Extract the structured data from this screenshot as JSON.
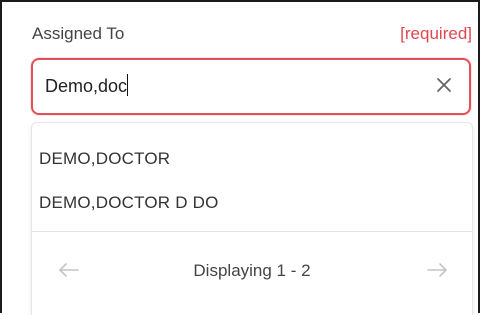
{
  "field": {
    "label": "Assigned To",
    "required_tag": "[required]",
    "value": "Demo,doc",
    "accent_color": "#e45057"
  },
  "dropdown": {
    "options": [
      {
        "label": "DEMO,DOCTOR"
      },
      {
        "label": "DEMO,DOCTOR D DO"
      }
    ],
    "pagination": {
      "status": "Displaying 1 - 2",
      "prev_icon": "arrow-left-icon",
      "next_icon": "arrow-right-icon"
    }
  },
  "icons": {
    "clear": "close-icon"
  }
}
